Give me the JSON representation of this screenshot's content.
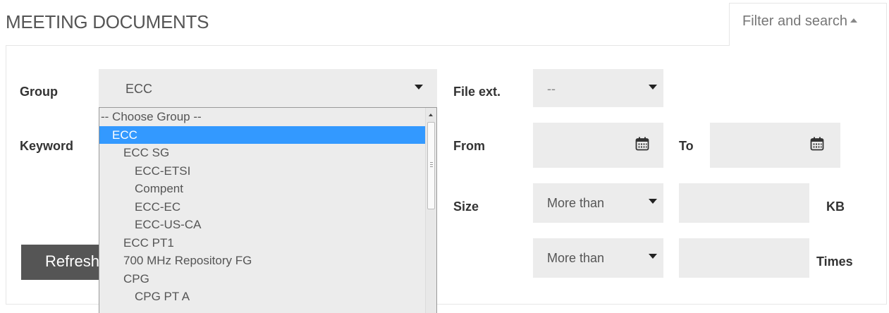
{
  "page": {
    "title": "MEETING DOCUMENTS",
    "filter_tab_label": "Filter and search"
  },
  "filters": {
    "group_label": "Group",
    "group_selected": "ECC",
    "keyword_label": "Keyword",
    "file_ext_label": "File ext.",
    "file_ext_selected": "--",
    "from_label": "From",
    "to_label": "To",
    "size_label": "Size",
    "size_op_selected": "More than",
    "size_unit": "KB",
    "times_op_selected": "More than",
    "times_unit": "Times",
    "refresh_label": "Refresh"
  },
  "group_options": [
    {
      "label": "-- Choose Group --",
      "level": 0,
      "selected": false
    },
    {
      "label": "ECC",
      "level": 1,
      "selected": true
    },
    {
      "label": "ECC SG",
      "level": 2,
      "selected": false
    },
    {
      "label": "ECC-ETSI",
      "level": 3,
      "selected": false
    },
    {
      "label": "Compent",
      "level": 3,
      "selected": false
    },
    {
      "label": "ECC-EC",
      "level": 3,
      "selected": false
    },
    {
      "label": "ECC-US-CA",
      "level": 3,
      "selected": false
    },
    {
      "label": "ECC PT1",
      "level": 2,
      "selected": false
    },
    {
      "label": "700 MHz Repository FG",
      "level": 2,
      "selected": false
    },
    {
      "label": "CPG",
      "level": 2,
      "selected": false
    },
    {
      "label": "CPG PT A",
      "level": 3,
      "selected": false
    }
  ],
  "colors": {
    "selected_option_bg": "#3399ff",
    "field_bg": "#ececec",
    "button_bg": "#555555"
  }
}
